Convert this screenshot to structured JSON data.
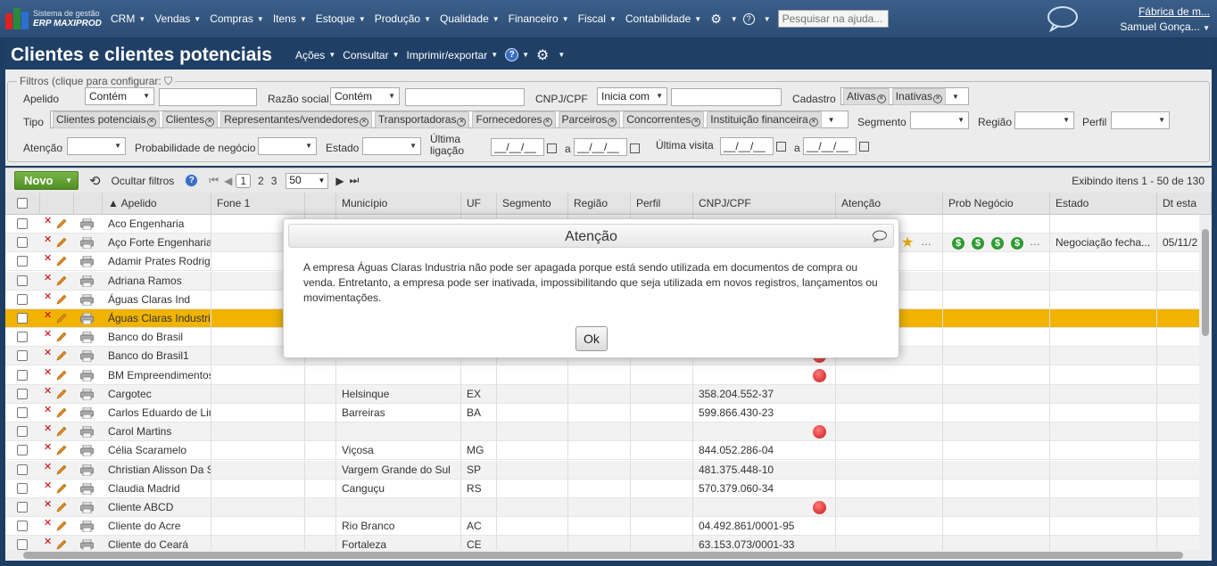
{
  "app": {
    "logo_line1": "Sistema de gestão",
    "logo_line2": "ERP MAXIPROD",
    "menu": [
      "CRM",
      "Vendas",
      "Compras",
      "Itens",
      "Estoque",
      "Produção",
      "Qualidade",
      "Financeiro",
      "Fiscal",
      "Contabilidade"
    ],
    "help_search_placeholder": "Pesquisar na ajuda...",
    "company": "Fábrica de m...",
    "user": "Samuel Gonça..."
  },
  "page": {
    "title": "Clientes e clientes potenciais",
    "actions": [
      "Ações",
      "Consultar",
      "Imprimir/exportar"
    ]
  },
  "filters": {
    "legend": "Filtros (clique para configurar:",
    "apelido_label": "Apelido",
    "apelido_op": "Contém",
    "razao_label": "Razão social",
    "razao_op": "Contém",
    "cnpj_label": "CNPJ/CPF",
    "cnpj_op": "Inicia com",
    "cadastro_label": "Cadastro",
    "cadastro_chips": [
      "Ativas",
      "Inativas"
    ],
    "tipo_label": "Tipo",
    "tipo_chips": [
      "Clientes potenciais",
      "Clientes",
      "Representantes/vendedores",
      "Transportadoras",
      "Fornecedores",
      "Parceiros",
      "Concorrentes",
      "Instituição financeira"
    ],
    "segmento_label": "Segmento",
    "regiao_label": "Região",
    "perfil_label": "Perfil",
    "atencao_label": "Atenção",
    "prob_label": "Probabilidade de negócio",
    "estado_label": "Estado",
    "ultima_ligacao_l1": "Última",
    "ultima_ligacao_l2": "ligação",
    "date_placeholder": "__/__/__",
    "a_label": "a",
    "ultima_visita_label": "Última visita"
  },
  "toolbar": {
    "novo_label": "Novo",
    "hide_filters": "Ocultar filtros",
    "pages": [
      "1",
      "2",
      "3"
    ],
    "page_size": "50",
    "showing": "Exibindo itens 1 - 50 de 130"
  },
  "grid": {
    "columns": [
      "Apelido",
      "Fone 1",
      "Município",
      "UF",
      "Segmento",
      "Região",
      "Perfil",
      "CNPJ/CPF",
      "Atenção",
      "Prob Negócio",
      "Estado",
      "Dt esta"
    ],
    "rows": [
      {
        "apelido": "Aco Engenharia",
        "municipio": "",
        "uf": "",
        "cnpj": "",
        "estado": "",
        "dt": ""
      },
      {
        "apelido": "Aço Forte Engenharia",
        "municipio": "",
        "uf": "",
        "cnpj": "",
        "estado": "Negociação fecha...",
        "dt": "05/11/2"
      },
      {
        "apelido": "Adamir Prates Rodrigu",
        "municipio": "",
        "uf": "",
        "cnpj": "",
        "estado": "",
        "dt": ""
      },
      {
        "apelido": "Adriana Ramos",
        "municipio": "",
        "uf": "",
        "cnpj": "",
        "estado": "",
        "dt": ""
      },
      {
        "apelido": "Águas Claras Ind",
        "municipio": "",
        "uf": "",
        "cnpj": "",
        "estado": "",
        "dt": ""
      },
      {
        "apelido": "Águas Claras Industria",
        "municipio": "",
        "uf": "",
        "cnpj": "",
        "estado": "",
        "dt": ""
      },
      {
        "apelido": "Banco do Brasil",
        "municipio": "",
        "uf": "",
        "cnpj": "",
        "estado": "",
        "dt": ""
      },
      {
        "apelido": "Banco do Brasil1",
        "municipio": "",
        "uf": "",
        "cnpj": "",
        "estado": "",
        "dt": ""
      },
      {
        "apelido": "BM Empreendimentos",
        "municipio": "",
        "uf": "",
        "cnpj": "",
        "estado": "",
        "dt": ""
      },
      {
        "apelido": "Cargotec",
        "municipio": "Helsinque",
        "uf": "EX",
        "cnpj": "358.204.552-37",
        "estado": "",
        "dt": ""
      },
      {
        "apelido": "Carlos Eduardo de Lim",
        "municipio": "Barreiras",
        "uf": "BA",
        "cnpj": "599.866.430-23",
        "estado": "",
        "dt": ""
      },
      {
        "apelido": "Carol Martins",
        "municipio": "",
        "uf": "",
        "cnpj": "",
        "estado": "",
        "dt": ""
      },
      {
        "apelido": "Célia Scaramelo",
        "municipio": "Viçosa",
        "uf": "MG",
        "cnpj": "844.052.286-04",
        "estado": "",
        "dt": ""
      },
      {
        "apelido": "Christian Alisson Da S",
        "municipio": "Vargem Grande do Sul",
        "uf": "SP",
        "cnpj": "481.375.448-10",
        "estado": "",
        "dt": ""
      },
      {
        "apelido": "Claudia Madrid",
        "municipio": "Canguçu",
        "uf": "RS",
        "cnpj": "570.379.060-34",
        "estado": "",
        "dt": ""
      },
      {
        "apelido": "Cliente ABCD",
        "municipio": "",
        "uf": "",
        "cnpj": "",
        "estado": "",
        "dt": ""
      },
      {
        "apelido": "Cliente do Acre",
        "municipio": "Rio Branco",
        "uf": "AC",
        "cnpj": "04.492.861/0001-95",
        "estado": "",
        "dt": ""
      },
      {
        "apelido": "Cliente do Ceará",
        "municipio": "Fortaleza",
        "uf": "CE",
        "cnpj": "63.153.073/0001-33",
        "estado": "",
        "dt": ""
      }
    ]
  },
  "modal": {
    "title": "Atenção",
    "message": "A empresa Águas Claras Industria não pode ser apagada porque está sendo utilizada em documentos de compra ou venda. Entretanto, a empresa pode ser inativada, impossibilitando que seja utilizada em novos registros, lançamentos ou movimentações.",
    "ok_label": "Ok"
  },
  "colors": {
    "highlight_row": "#f0b400",
    "header_blue": "#1f3f66",
    "novo_green": "#5a9a2a"
  }
}
